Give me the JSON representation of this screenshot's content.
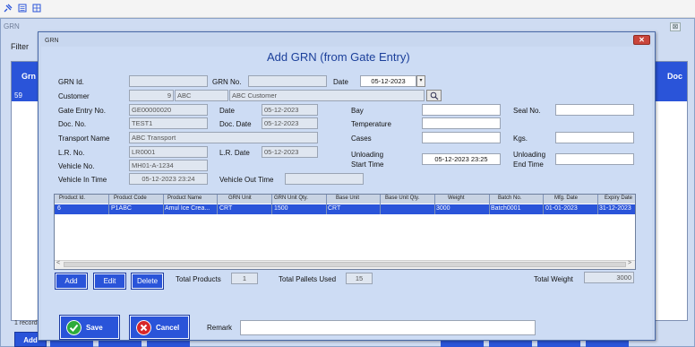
{
  "outer": {
    "title": "GRN",
    "close_glyph": "⊠",
    "filter_label": "Filter",
    "grid_col_partial": "Grn",
    "grid_col_doc_partial": "Doc",
    "grid_selected_row": "59",
    "records_label": "1 records",
    "add_label": "Add"
  },
  "dialog": {
    "title": "GRN",
    "close_glyph": "✕",
    "heading": "Add GRN (from Gate Entry)"
  },
  "form": {
    "grn_id_label": "GRN Id.",
    "grn_id": "",
    "grn_no_label": "GRN No.",
    "grn_no": "",
    "date_label": "Date",
    "date": "05-12-2023",
    "customer_label": "Customer",
    "customer_id": "9",
    "customer_code": "ABC",
    "customer_name": "ABC Customer",
    "gate_entry_no_label": "Gate Entry No.",
    "gate_entry_no": "GE00000020",
    "gate_date_label": "Date",
    "gate_date": "05-12-2023",
    "doc_no_label": "Doc. No.",
    "doc_no": "TEST1",
    "doc_date_label": "Doc. Date",
    "doc_date": "05-12-2023",
    "transport_name_label": "Transport Name",
    "transport_name": "ABC Transport",
    "lr_no_label": "L.R. No.",
    "lr_no": "LR0001",
    "lr_date_label": "L.R. Date",
    "lr_date": "05-12-2023",
    "vehicle_no_label": "Vehicle No.",
    "vehicle_no": "MH01-A-1234",
    "vehicle_in_time_label": "Vehicle In Time",
    "vehicle_in_time": "05-12-2023 23:24",
    "vehicle_out_time_label": "Vehicle Out Time",
    "vehicle_out_time": "",
    "bay_label": "Bay",
    "bay": "",
    "seal_no_label": "Seal No.",
    "seal_no": "",
    "temperature_label": "Temperature",
    "temperature": "",
    "cases_label": "Cases",
    "cases": "",
    "kgs_label": "Kgs.",
    "kgs": "",
    "unloading_start_label_1": "Unloading",
    "unloading_start_label_2": "Start Time",
    "unloading_start_time": "05-12-2023 23:25",
    "unloading_end_label_1": "Unloading",
    "unloading_end_label_2": "End Time",
    "unloading_end_time": ""
  },
  "grid": {
    "columns": [
      "Product Id.",
      "Product Code",
      "Product Name",
      "GRN Unit",
      "GRN Unit Qty.",
      "Base Unit",
      "Base Unit Qty.",
      "Weight",
      "Batch No.",
      "Mfg. Date",
      "Expiry Date"
    ],
    "rows": [
      [
        "6",
        "P1ABC",
        "Amul Ice Crea...",
        "CRT",
        "1500",
        "CRT",
        "",
        "3000",
        "Batch0001",
        "01-01-2023",
        "31-12-2023"
      ]
    ],
    "scroll_left_glyph": "<",
    "scroll_right_glyph": ">"
  },
  "actions": {
    "add_label": "Add",
    "edit_label": "Edit",
    "delete_label": "Delete",
    "total_products_label": "Total Products",
    "total_products": "1",
    "total_pallets_label": "Total Pallets Used",
    "total_pallets": "15",
    "total_weight_label": "Total Weight",
    "total_weight": "3000",
    "save_label": "Save",
    "cancel_label": "Cancel",
    "remark_label": "Remark",
    "remark": ""
  },
  "colors": {
    "accent_blue": "#2a54d9",
    "dialog_bg": "#c8d7ef",
    "close_red": "#c9453b",
    "save_icon_green": "#2eab3c",
    "cancel_icon_red": "#d7262a"
  },
  "icons": [
    "pin-icon",
    "list-icon",
    "columns-icon",
    "search-icon",
    "check-icon",
    "cancel-icon"
  ]
}
